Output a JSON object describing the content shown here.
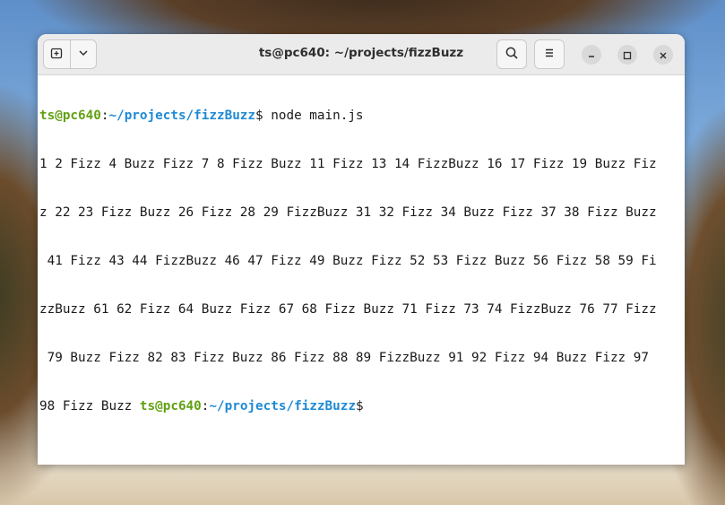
{
  "window": {
    "title": "ts@pc640: ~/projects/fizzBuzz"
  },
  "icons": {
    "new_tab": "new-tab-icon",
    "dropdown": "chevron-down-icon",
    "search": "search-icon",
    "menu": "hamburger-menu-icon",
    "minimize": "minimize-icon",
    "maximize": "maximize-icon",
    "close": "close-icon"
  },
  "terminal": {
    "prompt_user": "ts@pc640",
    "prompt_sep": ":",
    "prompt_path": "~/projects/fizzBuzz",
    "prompt_symbol": "$",
    "command": " node main.js",
    "output_lines": [
      "1 2 Fizz 4 Buzz Fizz 7 8 Fizz Buzz 11 Fizz 13 14 FizzBuzz 16 17 Fizz 19 Buzz Fiz",
      "z 22 23 Fizz Buzz 26 Fizz 28 29 FizzBuzz 31 32 Fizz 34 Buzz Fizz 37 38 Fizz Buzz",
      " 41 Fizz 43 44 FizzBuzz 46 47 Fizz 49 Buzz Fizz 52 53 Fizz Buzz 56 Fizz 58 59 Fi",
      "zzBuzz 61 62 Fizz 64 Buzz Fizz 67 68 Fizz Buzz 71 Fizz 73 74 FizzBuzz 76 77 Fizz",
      " 79 Buzz Fizz 82 83 Fizz Buzz 86 Fizz 88 89 FizzBuzz 91 92 Fizz 94 Buzz Fizz 97"
    ],
    "last_line_text": "98 Fizz Buzz ",
    "colors": {
      "user": "#61a012",
      "path": "#1f8ad3",
      "text": "#1a1a1a"
    }
  }
}
